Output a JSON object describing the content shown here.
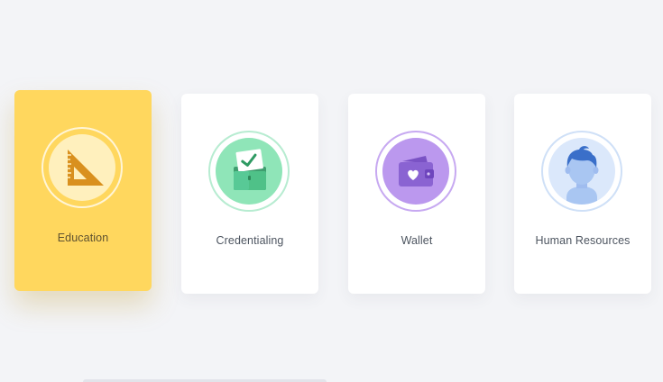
{
  "cards": [
    {
      "label": "Education",
      "icon": "set-square-icon",
      "active": true,
      "color": "#ffd75e"
    },
    {
      "label": "Credentialing",
      "icon": "folder-check-icon",
      "active": false,
      "color": "#8fe5b8"
    },
    {
      "label": "Wallet",
      "icon": "wallet-heart-icon",
      "active": false,
      "color": "#bb98ee"
    },
    {
      "label": "Human Resources",
      "icon": "person-avatar-icon",
      "active": false,
      "color": "#dbe8fb"
    }
  ],
  "colors": {
    "background": "#f3f4f7",
    "card": "#ffffff",
    "active_card": "#ffd75e"
  }
}
